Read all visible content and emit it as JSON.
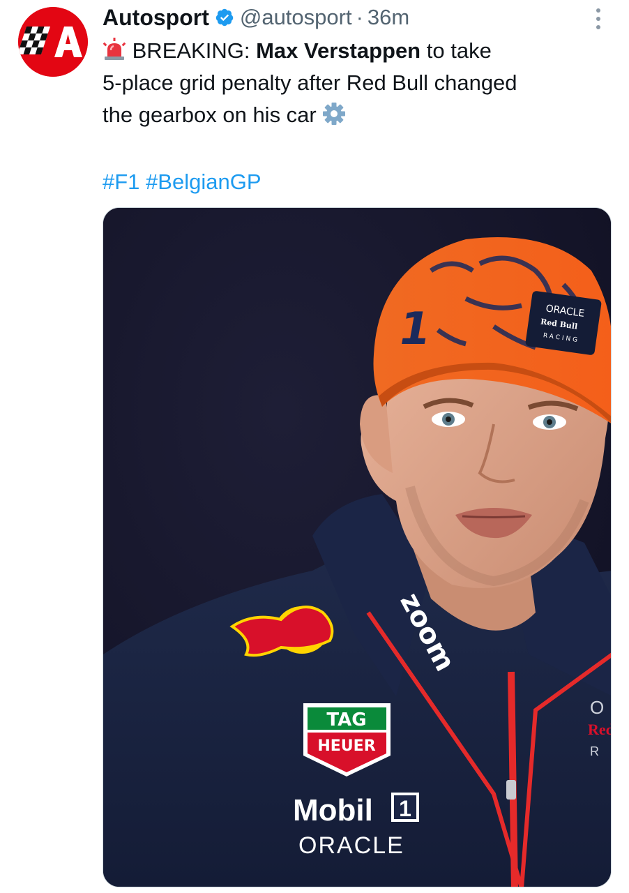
{
  "tweet": {
    "author": {
      "display_name": "Autosport",
      "handle": "@autosport",
      "verified": true,
      "avatar_icon": "autosport-logo"
    },
    "separator": "·",
    "time": "36m",
    "body": {
      "prefix_emoji": "rotating-light",
      "breaking": "BREAKING:",
      "name": "Max Verstappen",
      "text_1": "to take",
      "text_2": "5-place grid penalty after Red Bull changed",
      "text_3": "the gearbox on his car",
      "suffix_emoji": "gear"
    },
    "hashtags": [
      "#F1",
      "#BelgianGP"
    ],
    "media": {
      "alt": "photo",
      "sponsor_text": {
        "cap_line1": "ORACLE",
        "cap_line2": "Red Bull",
        "cap_line3": "RACING",
        "cap_number": "1",
        "collar": "zoom",
        "tag1": "TAG",
        "tag2": "HEUER",
        "mobil": "Mobil",
        "mobil_num": "1",
        "oracle": "ORACLE",
        "right1": "O",
        "right2": "Red",
        "right3": "R"
      }
    },
    "colors": {
      "link": "#1d9bf0",
      "secondary": "#536471",
      "brand_red": "#e30613",
      "verified": "#1d9bf0"
    }
  }
}
